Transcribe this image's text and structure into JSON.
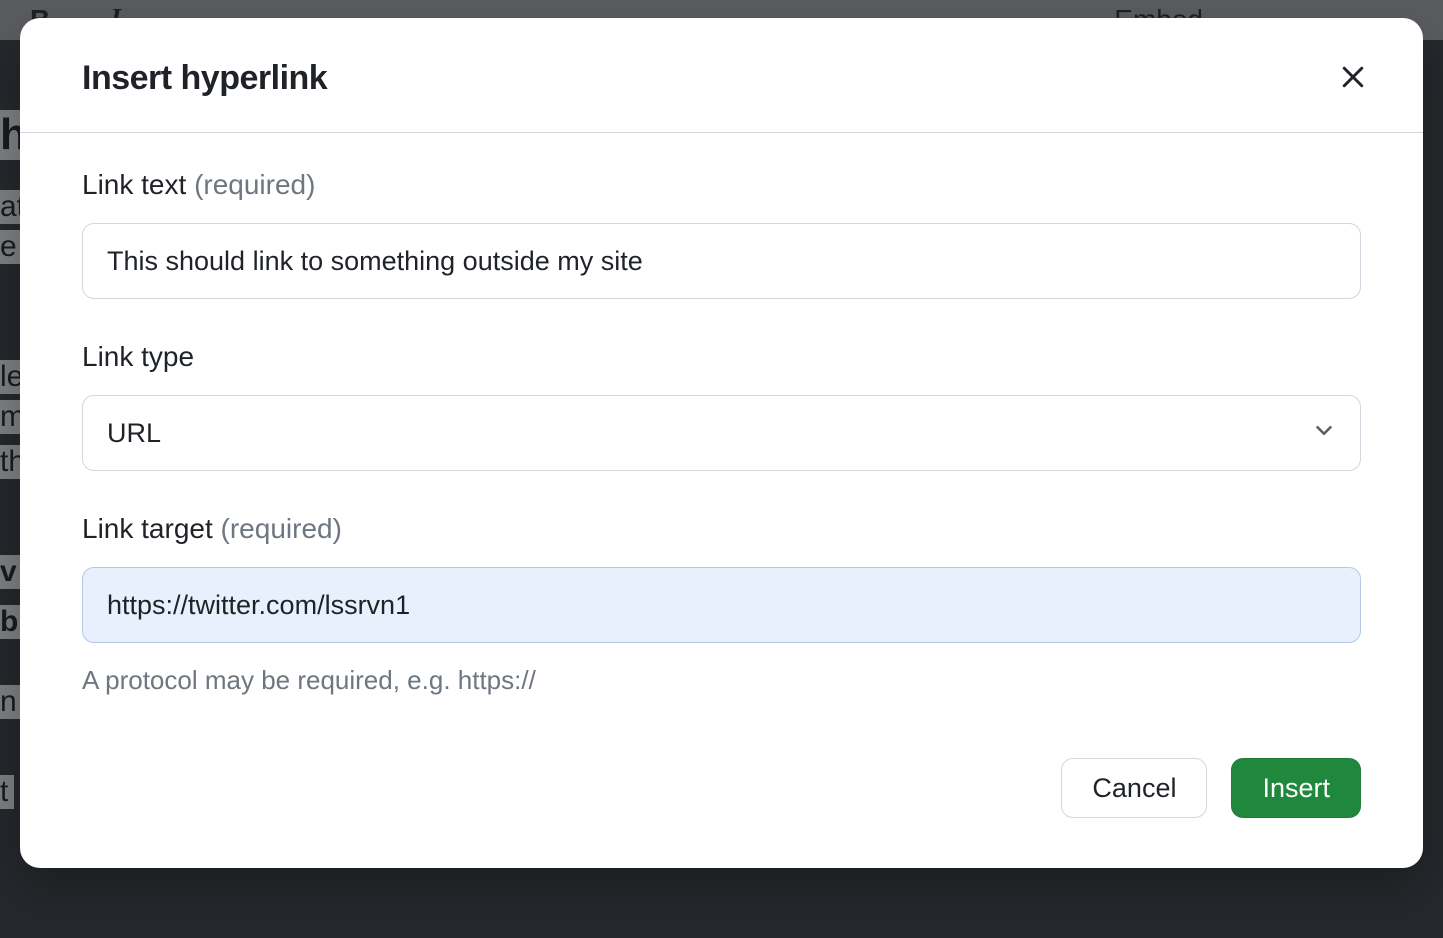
{
  "background": {
    "toolbar": {
      "bold": "B",
      "embed_label": "Embed"
    },
    "frag1": "h",
    "frag2": "at",
    "frag3": "e",
    "frag4": "le",
    "frag5": "m",
    "frag6": "th",
    "frag7": "v",
    "frag8": "b",
    "frag9": "n",
    "frag10": "t"
  },
  "modal": {
    "title": "Insert hyperlink",
    "link_text": {
      "label": "Link text",
      "required": "(required)",
      "value": "This should link to something outside my site"
    },
    "link_type": {
      "label": "Link type",
      "value": "URL"
    },
    "link_target": {
      "label": "Link target",
      "required": "(required)",
      "value": "https://twitter.com/lssrvn1",
      "hint": "A protocol may be required, e.g. https://"
    },
    "cancel_label": "Cancel",
    "insert_label": "Insert"
  }
}
